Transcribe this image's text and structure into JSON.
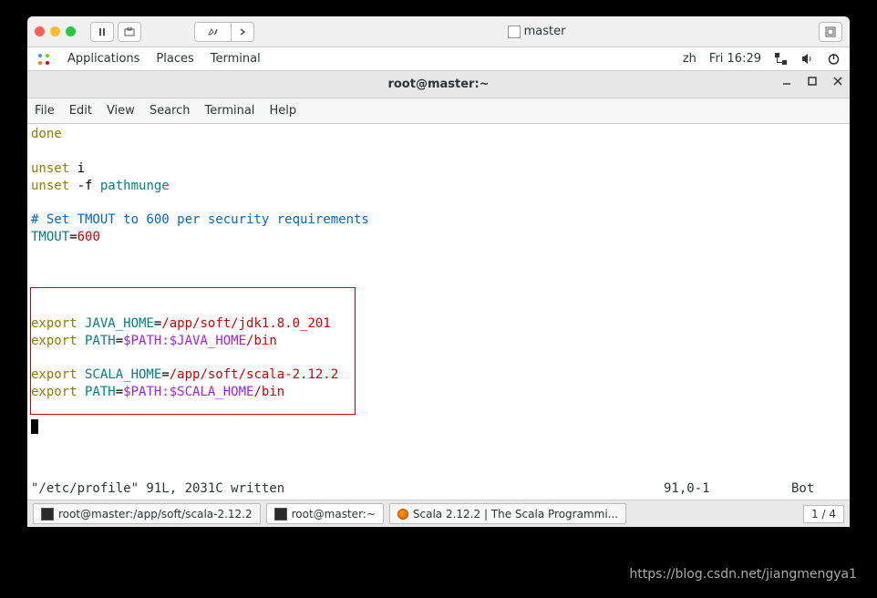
{
  "vm": {
    "title": "master"
  },
  "gnome": {
    "apps": "Applications",
    "places": "Places",
    "terminal": "Terminal",
    "lang": "zh",
    "time": "Fri 16:29"
  },
  "window": {
    "title": "root@master:~"
  },
  "menubar": {
    "file": "File",
    "edit": "Edit",
    "view": "View",
    "search": "Search",
    "terminal": "Terminal",
    "help": "Help"
  },
  "term": {
    "l1_done": "done",
    "l3_unset": "unset",
    "l3_i": " i",
    "l4_unset": "unset",
    "l4_flag": " -f ",
    "l4_path": "pathmunge",
    "l6_comment": "# Set TMOUT to 600 per security requirements",
    "l7_tmout": "TMOUT",
    "l7_eq": "=",
    "l7_600": "600",
    "ex": "export",
    "jh": " JAVA_HOME",
    "eq": "=",
    "jh_path": "/app/soft/jdk1.8.0_201",
    "path": " PATH",
    "pathval_j": "$PATH:$JAVA_HOME",
    "bin": "/bin",
    "sh": " SCALA_HOME",
    "sh_path": "/app/soft/scala-2.12.2",
    "pathval_s": "$PATH:$SCALA_HOME"
  },
  "status": {
    "left": "\"/etc/profile\" 91L, 2031C written",
    "mid": "91,0-1",
    "right": "Bot"
  },
  "taskbar": {
    "item1": "root@master:/app/soft/scala-2.12.2",
    "item2": "root@master:~",
    "item3": "Scala 2.12.2 | The Scala Programmi...",
    "workspace": "1 / 4"
  },
  "watermark": "https://blog.csdn.net/jiangmengya1"
}
